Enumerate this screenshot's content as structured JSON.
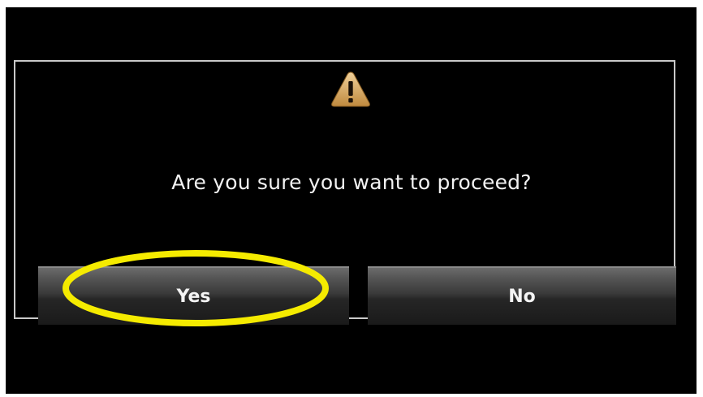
{
  "dialog": {
    "icon": "warning-icon",
    "message": "Are you sure you want to proceed?",
    "buttons": {
      "yes_label": "Yes",
      "no_label": "No"
    }
  },
  "annotation": {
    "shape": "ellipse",
    "color": "#f5eb00",
    "target": "yes-button"
  },
  "colors": {
    "background": "#000000",
    "dialog_border": "#c9c9c9",
    "text": "#f2f2f2",
    "warning_fill": "#d4a45a"
  }
}
